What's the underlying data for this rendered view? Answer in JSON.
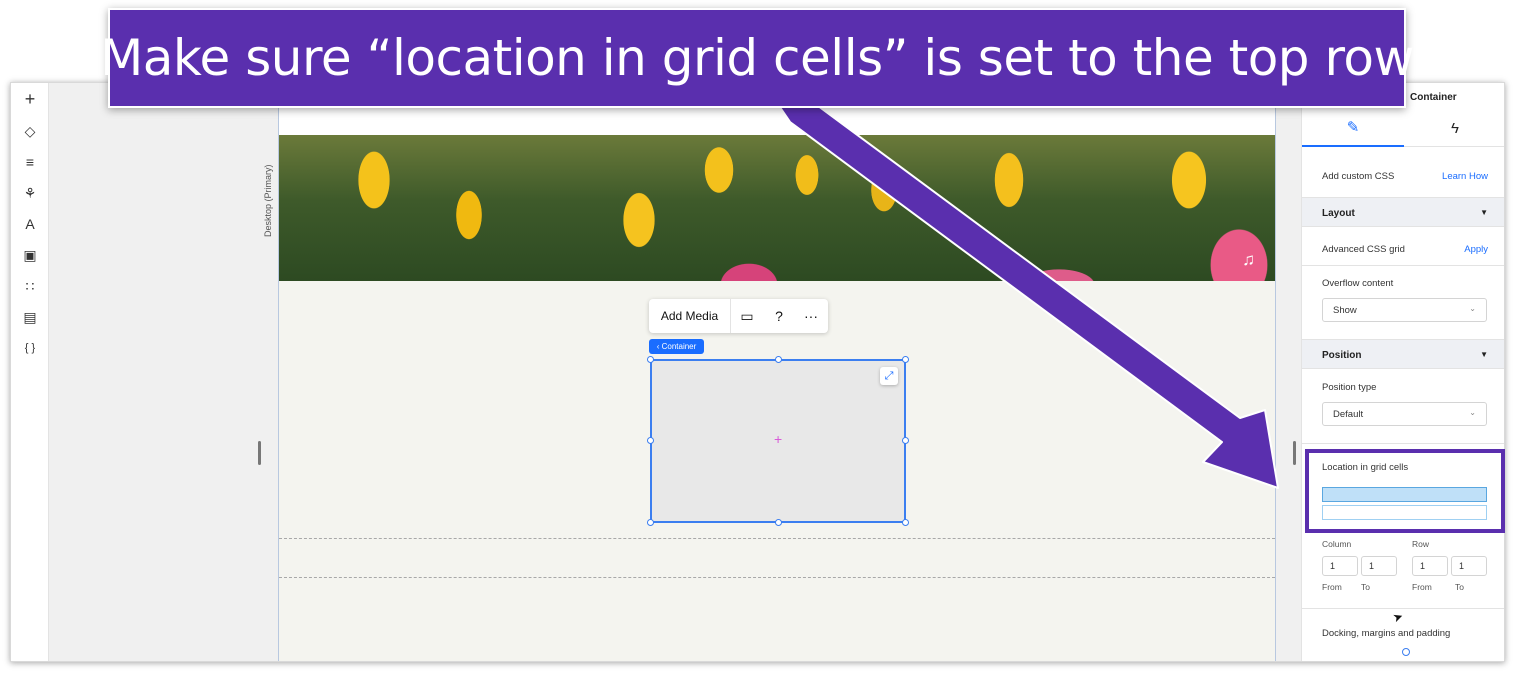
{
  "banner": {
    "text": "Make sure “location in grid cells” is set to the top row"
  },
  "toolbar": {
    "tools": [
      {
        "icon": "plus-icon",
        "glyph": "+"
      },
      {
        "icon": "layers-icon",
        "glyph": "◇"
      },
      {
        "icon": "page-icon",
        "glyph": "≡"
      },
      {
        "icon": "components-icon",
        "glyph": "⚘"
      },
      {
        "icon": "typography-icon",
        "glyph": "A"
      },
      {
        "icon": "image-icon",
        "glyph": "▣"
      },
      {
        "icon": "apps-icon",
        "glyph": "∷"
      },
      {
        "icon": "table-icon",
        "glyph": "▤"
      },
      {
        "icon": "code-icon",
        "glyph": "{ }"
      }
    ]
  },
  "canvas": {
    "device_label": "Desktop (Primary)",
    "floating_bar": {
      "add_media": "Add Media"
    },
    "container_tag": "‹ Container"
  },
  "inspector": {
    "title": "Container",
    "custom_css": {
      "label": "Add custom CSS",
      "link": "Learn How"
    },
    "layout": {
      "heading": "Layout",
      "advanced_css_grid": "Advanced CSS grid",
      "apply": "Apply",
      "overflow_label": "Overflow content",
      "overflow_value": "Show"
    },
    "position": {
      "heading": "Position",
      "type_label": "Position type",
      "type_value": "Default",
      "location_label": "Location in grid cells",
      "column_label": "Column",
      "row_label": "Row",
      "col_from": "1",
      "col_to": "1",
      "row_from": "1",
      "row_to": "1",
      "from_label": "From",
      "to_label": "To"
    },
    "docking_label": "Docking, margins and padding"
  }
}
